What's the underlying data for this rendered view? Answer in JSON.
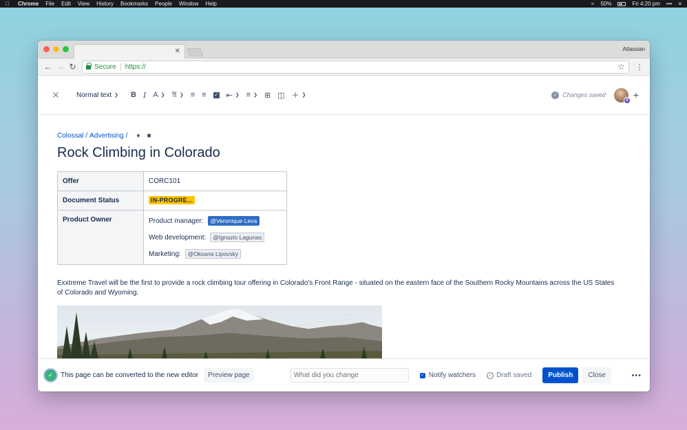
{
  "os_menubar": {
    "app": "Chrome",
    "items": [
      "File",
      "Edit",
      "View",
      "History",
      "Bookmarks",
      "People",
      "Window",
      "Help"
    ],
    "battery": "50%",
    "clock": "Fri 4:20 pm"
  },
  "browser": {
    "profile": "Atlassian",
    "secure_label": "Secure",
    "url": "https://"
  },
  "toolbar": {
    "text_style": "Normal text",
    "bold": "B",
    "italic": "I",
    "text_color": "A",
    "saved_status": "Changes saved",
    "avatar_badge": "V"
  },
  "page": {
    "breadcrumb": [
      "Colossal",
      "Advertising"
    ],
    "title": "Rock Climbing in Colorado",
    "table": {
      "offer_label": "Offer",
      "offer_value": "CORC101",
      "status_label": "Document Status",
      "status_value": "IN-PROGRE...",
      "owner_label": "Product Owner",
      "owners": [
        {
          "role": "Product manager:",
          "mention": "@Veronique Leva"
        },
        {
          "role": "Web development:",
          "mention": "@Ignazio Lagunas"
        },
        {
          "role": "Marketing:",
          "mention": "@Oksana Lipovsky"
        }
      ]
    },
    "body": "Exxtreme Travel will be the first to provide a rock climbing tour offering in Colorado's Front Range - situated on the eastern face of the Southern Rocky Mountains across the US States of Colorado and Wyoming."
  },
  "bottombar": {
    "convert_text": "This page can be converted to the new editor",
    "preview_label": "Preview page",
    "change_placeholder": "What did you change",
    "notify_label": "Notify watchers",
    "draft_label": "Draft saved",
    "publish_label": "Publish",
    "close_label": "Close"
  },
  "colors": {
    "primary": "#0052cc",
    "status": "#ffc400",
    "success": "#36b37e"
  }
}
